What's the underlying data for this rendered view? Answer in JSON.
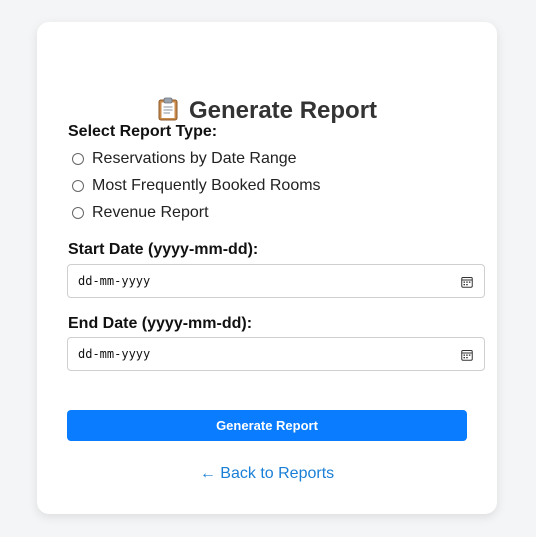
{
  "page": {
    "title": "Generate Report",
    "title_icon": "clipboard-icon"
  },
  "report_type": {
    "label": "Select Report Type:",
    "options": [
      {
        "label": "Reservations by Date Range",
        "selected": false
      },
      {
        "label": "Most Frequently Booked Rooms",
        "selected": false
      },
      {
        "label": "Revenue Report",
        "selected": false
      }
    ]
  },
  "start_date": {
    "label": "Start Date (yyyy-mm-dd):",
    "placeholder": "dd-mm-yyyy",
    "icon": "calendar-icon"
  },
  "end_date": {
    "label": "End Date (yyyy-mm-dd):",
    "placeholder": "dd-mm-yyyy",
    "icon": "calendar-icon"
  },
  "actions": {
    "submit_label": "Generate Report",
    "back_label": "← Back to Reports"
  },
  "colors": {
    "accent": "#0a7cff",
    "link": "#1a7fd6",
    "background": "#f4f5f7",
    "card": "#ffffff"
  }
}
